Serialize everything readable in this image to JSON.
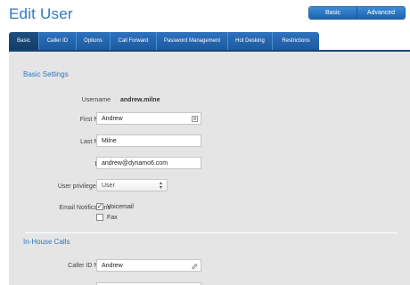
{
  "page": {
    "title": "Edit User"
  },
  "mode_switch": {
    "basic_label": "Basic",
    "advanced_label": "Advanced"
  },
  "tabs": [
    {
      "label": "Basic",
      "active": true
    },
    {
      "label": "Caller ID",
      "active": false
    },
    {
      "label": "Options",
      "active": false
    },
    {
      "label": "Call Forward",
      "active": false
    },
    {
      "label": "Password Management",
      "active": false
    },
    {
      "label": "Hot Desking",
      "active": false
    },
    {
      "label": "Restrictions",
      "active": false
    }
  ],
  "basic_settings": {
    "section_title": "Basic Settings",
    "username": {
      "label": "Username",
      "value": "andrew.milne"
    },
    "first_name": {
      "label": "First Name",
      "value": "Andrew"
    },
    "last_name": {
      "label": "Last Name",
      "value": "Milne"
    },
    "email": {
      "label": "Email",
      "value": "andrew@dynamo6.com"
    },
    "privilege": {
      "label": "User privilege level",
      "selected": "User"
    },
    "notifications": {
      "label": "Email Notifications",
      "options": [
        {
          "label": "Voicemail",
          "checked": true
        },
        {
          "label": "Fax",
          "checked": false
        }
      ]
    }
  },
  "in_house_calls": {
    "section_title": "In-House Calls",
    "caller_id_name": {
      "label": "Caller ID Name",
      "value": "Andrew"
    }
  },
  "icons": {
    "field_menu": "contact-card-icon",
    "field_clear": "pencil-icon"
  },
  "colors": {
    "accent": "#2f77c0",
    "tab_bg": "#1c5aa0",
    "tab_active_bg": "#143d67",
    "panel_bg": "#e5e5e5"
  }
}
